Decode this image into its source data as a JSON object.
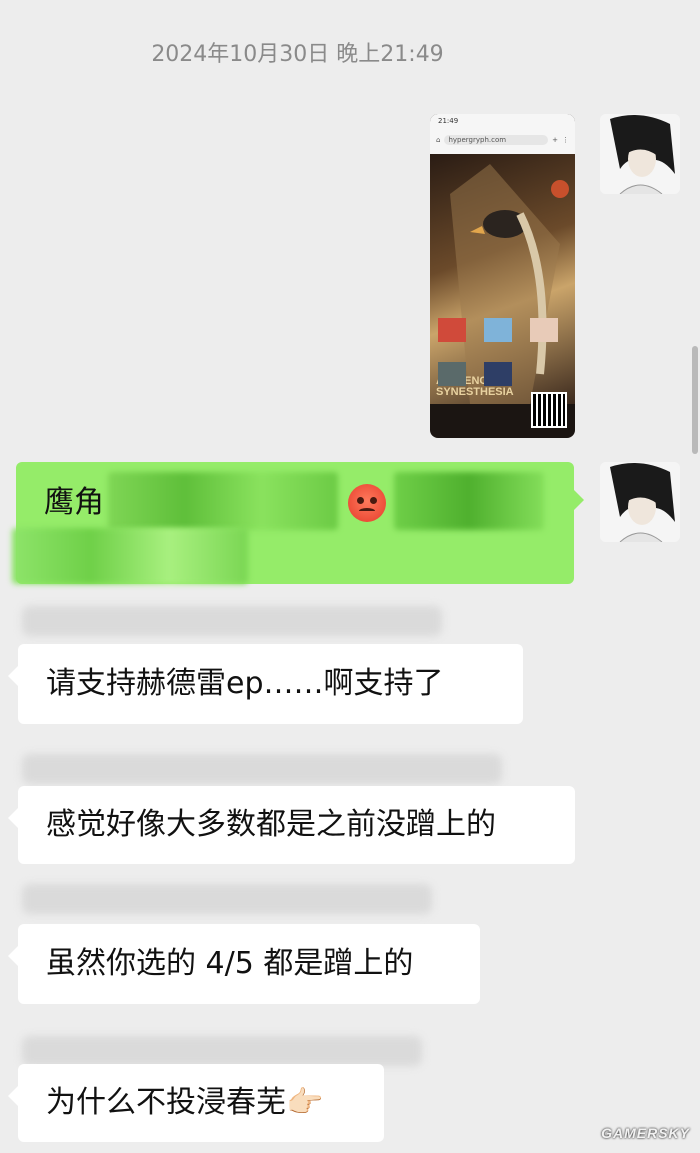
{
  "chat": {
    "timestamp": "2024年10月30日 晚上21:49",
    "shared_image": {
      "status_time": "21:49",
      "url": "hypergryph.com",
      "album_title_line1": "AMBIENCE",
      "album_title_line2": "SYNESTHESIA"
    },
    "messages": [
      {
        "sender": "self",
        "text": "鹰角"
      },
      {
        "sender": "other",
        "text": "请支持赫德雷ep……啊支持了"
      },
      {
        "sender": "other",
        "text": "感觉好像大多数都是之前没蹭上的"
      },
      {
        "sender": "other",
        "text": "虽然你选的 4/5 都是蹭上的"
      },
      {
        "sender": "other",
        "text": "为什么不投浸春芜"
      }
    ],
    "icons": {
      "angry_emoji": "angry-face-icon",
      "pointing_hand": "backhand-index-pointing-right-icon"
    },
    "hand_glyph": "👉🏻"
  },
  "watermark": "GAMERSKY"
}
